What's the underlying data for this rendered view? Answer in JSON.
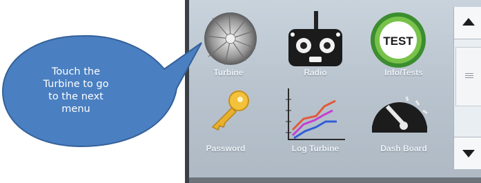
{
  "menu": {
    "items": [
      {
        "label": "Turbine",
        "icon": "turbine-icon"
      },
      {
        "label": "Radio",
        "icon": "radio-transmitter-icon"
      },
      {
        "label": "Info/Tests",
        "icon": "test-badge-icon",
        "badge_text": "TEST"
      },
      {
        "label": "Password",
        "icon": "key-icon"
      },
      {
        "label": "Log Turbine",
        "icon": "line-chart-icon"
      },
      {
        "label": "Dash Board",
        "icon": "gauge-icon"
      }
    ]
  },
  "callout": {
    "text": "Touch the Turbine to go to the next menu",
    "fill": "#4a7fc1",
    "stroke": "#34619a"
  },
  "colors": {
    "screen_bg": "#c0cad4",
    "label_color": "#eef3f7",
    "test_badge_green": "#4caf50"
  }
}
